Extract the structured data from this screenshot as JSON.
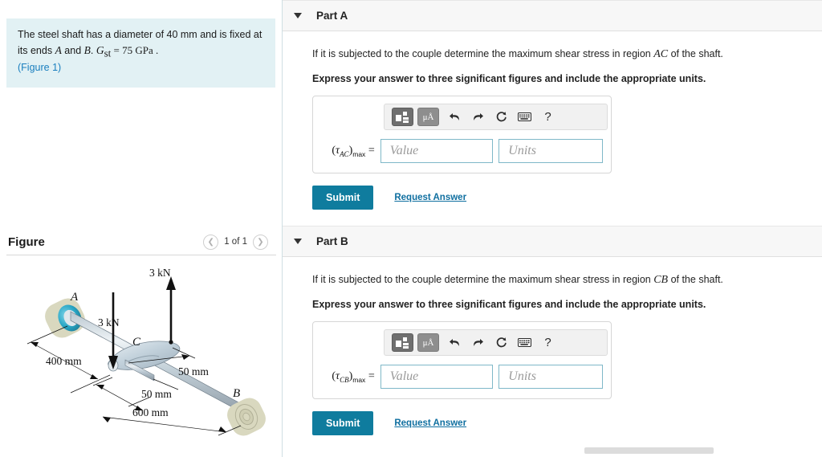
{
  "problem": {
    "text_part1": "The steel shaft has a diameter of 40 mm and is fixed at its ends ",
    "point_a": "A",
    "and_text": " and ",
    "point_b": "B",
    "modulus_symbol": "G",
    "modulus_sub": "st",
    "modulus_value": " = 75  GPa .",
    "figure_link": "(Figure 1)",
    "full_text": "The steel shaft has a diameter of 40 mm and is fixed at its ends A and B. Gst = 75 GPa. (Figure 1)"
  },
  "figure": {
    "title": "Figure",
    "counter": "1 of 1",
    "prev_icon": "chevron-left-icon",
    "next_icon": "chevron-right-icon",
    "labels": {
      "support_a": "A",
      "support_b": "B",
      "coupling_c": "C",
      "force_left": "3 kN",
      "force_right": "3 kN",
      "dim_400": "400 mm",
      "dim_50a": "50 mm",
      "dim_50b": "50 mm",
      "dim_600": "600 mm"
    }
  },
  "parts": [
    {
      "header": "Part A",
      "collapse_icon": "triangle-down-icon",
      "prompt_pre": "If it is subjected to the couple determine the maximum shear stress in region ",
      "prompt_region": "AC",
      "prompt_post": " of the shaft.",
      "express": "Express your answer to three significant figures and include the appropriate units.",
      "variable_main": "τ",
      "variable_sub": "AC",
      "variable_max": "max",
      "equals": "=",
      "value_placeholder": "Value",
      "units_placeholder": "Units",
      "value_text": "",
      "units_text": "",
      "submit_label": "Submit",
      "request_label": "Request Answer",
      "toolbar": {
        "template_icon": "math-template-icon",
        "units_icon": "μÅ",
        "undo_icon": "↶",
        "redo_icon": "↷",
        "reset_icon": "⟳",
        "keyboard_icon": "keyboard-icon",
        "help_icon": "?"
      }
    },
    {
      "header": "Part B",
      "collapse_icon": "triangle-down-icon",
      "prompt_pre": "If it is subjected to the couple determine the maximum shear stress in region ",
      "prompt_region": "CB",
      "prompt_post": " of the shaft.",
      "express": "Express your answer to three significant figures and include the appropriate units.",
      "variable_main": "τ",
      "variable_sub": "CB",
      "variable_max": "max",
      "equals": "=",
      "value_placeholder": "Value",
      "units_placeholder": "Units",
      "value_text": "",
      "units_text": "",
      "submit_label": "Submit",
      "request_label": "Request Answer",
      "toolbar": {
        "template_icon": "math-template-icon",
        "units_icon": "μÅ",
        "undo_icon": "↶",
        "redo_icon": "↷",
        "reset_icon": "⟳",
        "keyboard_icon": "keyboard-icon",
        "help_icon": "?"
      }
    }
  ],
  "colors": {
    "statement_bg": "#e2f1f4",
    "submit_bg": "#0f7c9e",
    "link": "#1a7fbf",
    "input_border": "#7fb8c8",
    "part_header_bg": "#f7f7f7"
  }
}
